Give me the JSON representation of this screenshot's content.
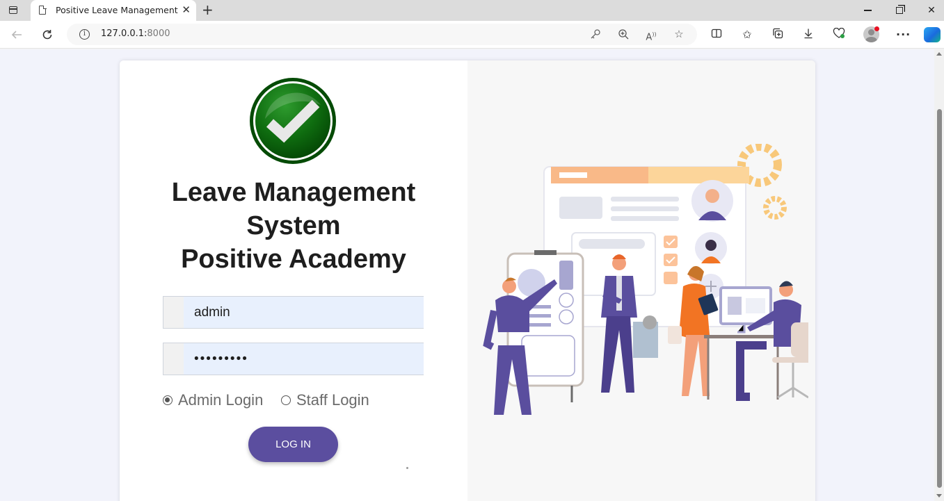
{
  "browser": {
    "tab_title": "Positive Leave Management",
    "new_tab_symbol": "+",
    "close_tab_symbol": "✕",
    "url_host": "127.0.0.1:",
    "url_port": "8000",
    "window_controls": {
      "minimize": "—",
      "restore": "❐",
      "close": "✕"
    }
  },
  "page": {
    "title_lines": [
      "Leave Management",
      "System",
      "Positive Academy"
    ],
    "username": {
      "value": "admin",
      "placeholder": ""
    },
    "password": {
      "value": "positive1",
      "placeholder": ""
    },
    "login_type": {
      "options": [
        "Admin Login",
        "Staff Login"
      ],
      "selected": "Admin Login"
    },
    "login_button": "LOG IN"
  },
  "colors": {
    "brand_purple": "#5b4e9f",
    "logo_green": "#0b6b0b",
    "input_fill": "#e8f0fd",
    "page_background": "#f2f3fb"
  },
  "icons": {
    "logo": "green-checkmark-icon",
    "illustration": "team-management-illustration"
  }
}
